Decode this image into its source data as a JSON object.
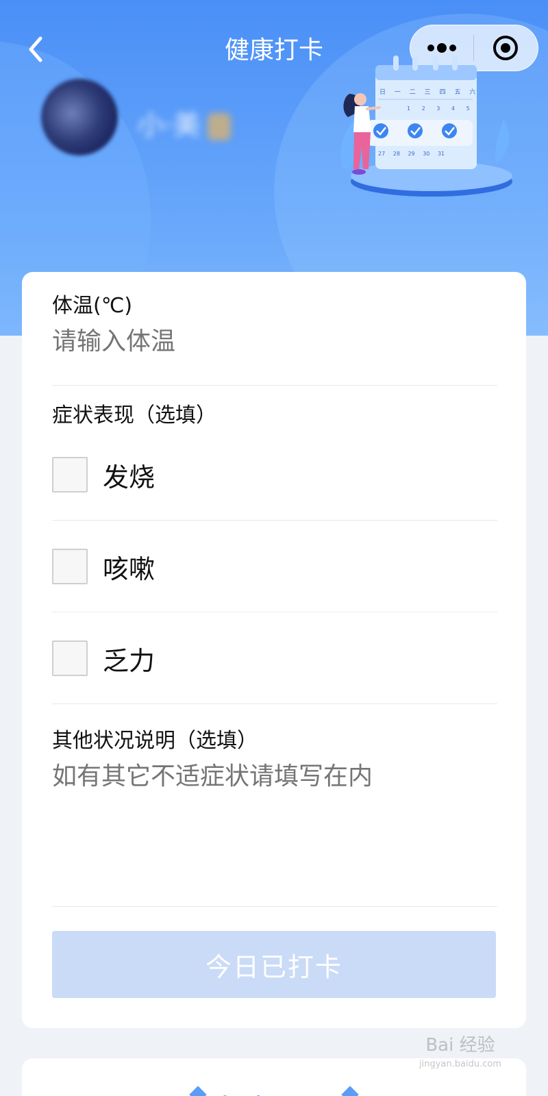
{
  "header": {
    "title": "健康打卡",
    "user_name": "小·美"
  },
  "form": {
    "temperature_label": "体温(℃)",
    "temperature_placeholder": "请输入体温",
    "symptoms_label": "症状表现（选填）",
    "symptoms": [
      {
        "label": "发烧",
        "checked": false
      },
      {
        "label": "咳嗽",
        "checked": false
      },
      {
        "label": "乏力",
        "checked": false
      }
    ],
    "other_label": "其他状况说明（选填）",
    "other_placeholder": "如有其它不适症状请填写在内",
    "submit_label": "今日已打卡"
  },
  "records": {
    "title": "打卡记录"
  },
  "calendar": {
    "weekdays": [
      "日",
      "一",
      "二",
      "三",
      "四",
      "五",
      "六"
    ],
    "days_row1": [
      "1",
      "2",
      "3",
      "4",
      "5"
    ],
    "days_row2": [
      "27",
      "28",
      "29",
      "30",
      "31"
    ]
  },
  "watermark": {
    "main": "Bai 经验",
    "sub": "jingyan.baidu.com"
  },
  "colors": {
    "header_blue": "#4a8ff7",
    "button_disabled": "#cadbf7",
    "records_accent": "#5b9cf8"
  }
}
